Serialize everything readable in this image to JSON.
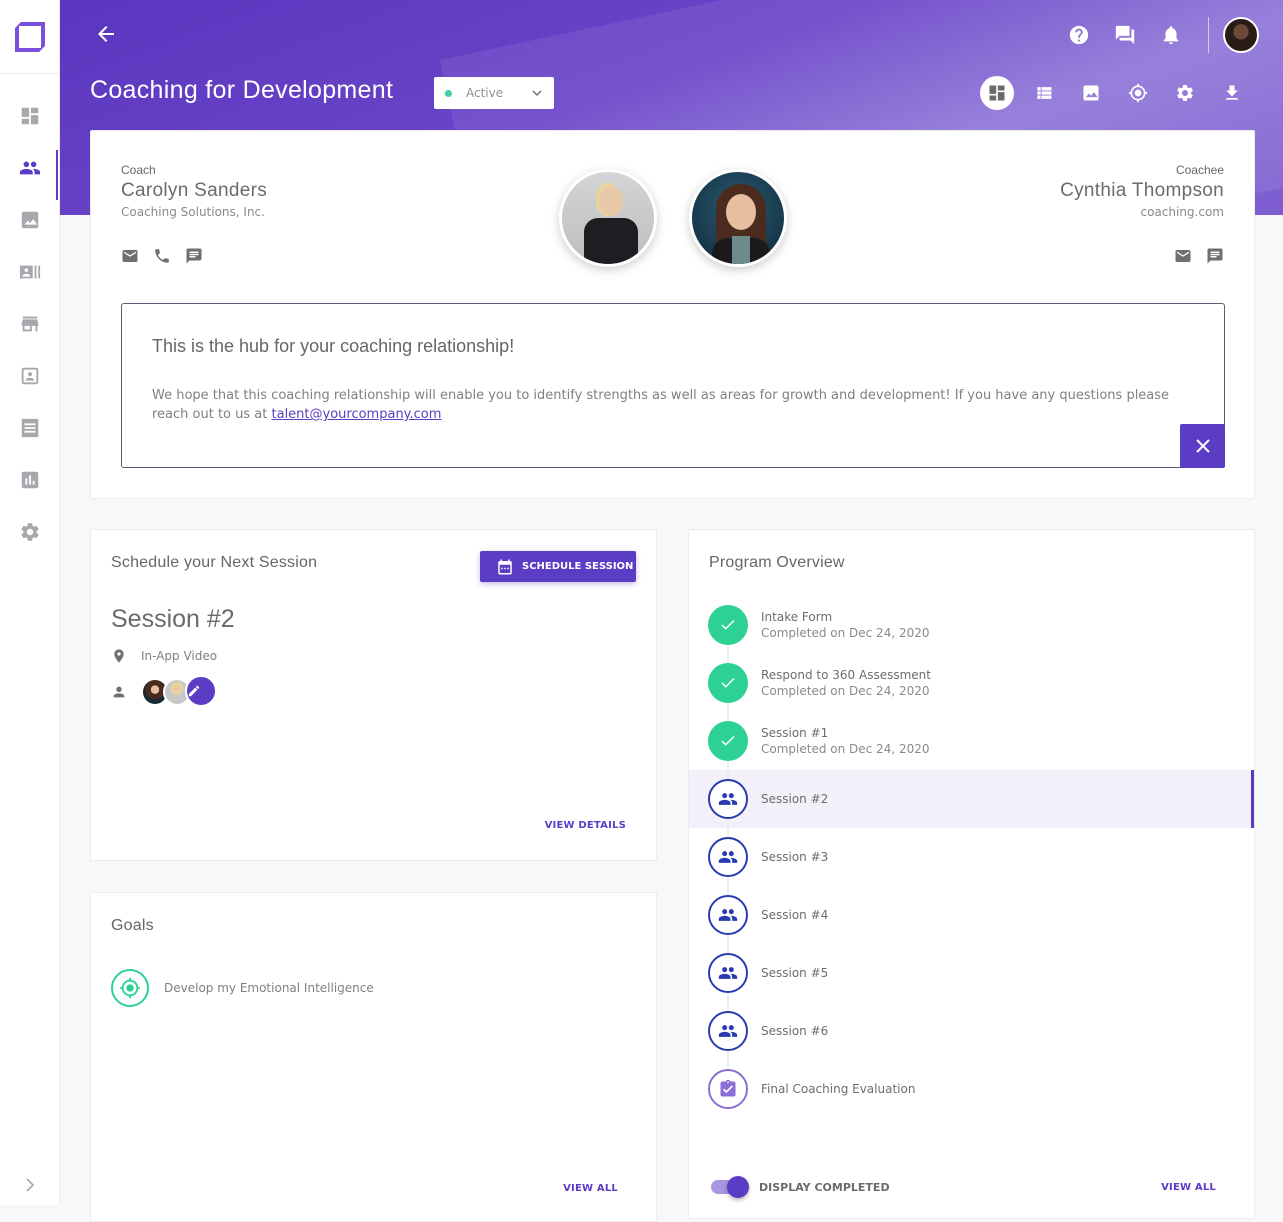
{
  "app": {
    "title": "Coaching for Development",
    "status": {
      "label": "Active",
      "color": "#2ed194"
    },
    "accent": "#5b3cc4"
  },
  "sidebar": {
    "items": [
      {
        "icon": "dashboard-icon",
        "label": "Dashboard"
      },
      {
        "icon": "people-icon",
        "label": "Coaching",
        "active": true
      },
      {
        "icon": "image-icon",
        "label": "Media"
      },
      {
        "icon": "contacts-list-icon",
        "label": "Directory"
      },
      {
        "icon": "store-icon",
        "label": "Marketplace"
      },
      {
        "icon": "portrait-icon",
        "label": "Profiles"
      },
      {
        "icon": "receipt-icon",
        "label": "Reports"
      },
      {
        "icon": "bar-chart-icon",
        "label": "Analytics"
      },
      {
        "icon": "gear-icon",
        "label": "Settings"
      }
    ]
  },
  "header": {
    "top_icons": [
      "help-icon",
      "chat-icon",
      "bell-icon"
    ],
    "view_icons": [
      "dashboard-view-icon",
      "list-view-icon",
      "image-view-icon",
      "target-view-icon",
      "settings-icon",
      "download-icon"
    ]
  },
  "hub": {
    "coach": {
      "label": "Coach",
      "name": "Carolyn Sanders",
      "org": "Coaching Solutions, Inc."
    },
    "coachee": {
      "label": "Coachee",
      "name": "Cynthia Thompson",
      "org": "coaching.com"
    },
    "message": {
      "title": "This is the hub for your coaching relationship!",
      "body": "We hope that this coaching relationship will enable you to identify strengths as well as areas for growth and development! If you have any questions please reach out to us at ",
      "email": "talent@yourcompany.com"
    }
  },
  "schedule": {
    "title": "Schedule your Next Session",
    "button": "SCHEDULE SESSION",
    "session_title": "Session #2",
    "location": "In-App Video",
    "view_details": "VIEW DETAILS"
  },
  "goals": {
    "title": "Goals",
    "items": [
      {
        "label": "Develop my Emotional Intelligence"
      }
    ],
    "view_all": "VIEW ALL"
  },
  "program": {
    "title": "Program Overview",
    "steps": [
      {
        "label": "Intake Form",
        "status": "Completed on Dec 24, 2020",
        "type": "done"
      },
      {
        "label": "Respond to 360 Assessment",
        "status": "Completed on Dec 24, 2020",
        "type": "done"
      },
      {
        "label": "Session #1",
        "status": "Completed on Dec 24, 2020",
        "type": "done"
      },
      {
        "label": "Session #2",
        "type": "session",
        "current": true
      },
      {
        "label": "Session #3",
        "type": "session"
      },
      {
        "label": "Session #4",
        "type": "session"
      },
      {
        "label": "Session #5",
        "type": "session"
      },
      {
        "label": "Session #6",
        "type": "session"
      },
      {
        "label": "Final Coaching Evaluation",
        "type": "evaluation"
      }
    ],
    "toggle_label": "DISPLAY COMPLETED",
    "toggle_on": true,
    "view_all": "VIEW ALL"
  }
}
